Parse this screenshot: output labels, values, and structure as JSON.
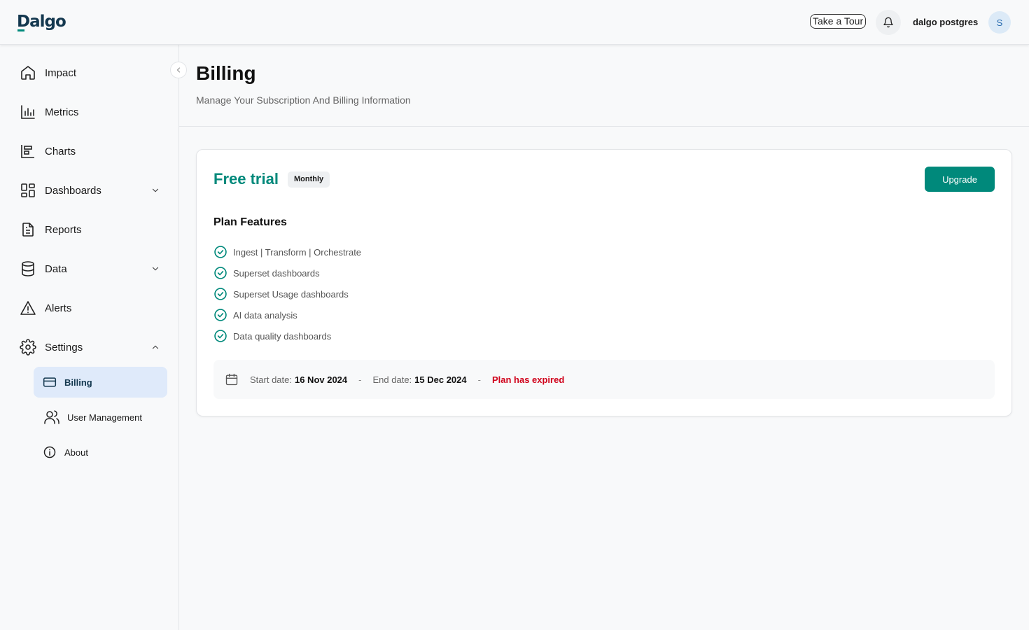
{
  "header": {
    "logo": "Dalgo",
    "tour_label": "Take a Tour",
    "user_name": "dalgo postgres",
    "avatar_initial": "S"
  },
  "sidebar": {
    "items": [
      {
        "label": "Impact",
        "icon": "home-icon"
      },
      {
        "label": "Metrics",
        "icon": "bar-chart-icon"
      },
      {
        "label": "Charts",
        "icon": "chart-icon"
      },
      {
        "label": "Dashboards",
        "icon": "grid-icon",
        "expandable": true
      },
      {
        "label": "Reports",
        "icon": "document-icon"
      },
      {
        "label": "Data",
        "icon": "database-icon",
        "expandable": true
      },
      {
        "label": "Alerts",
        "icon": "warning-icon"
      },
      {
        "label": "Settings",
        "icon": "gear-icon",
        "expanded": true
      }
    ],
    "subitems": [
      {
        "label": "Billing",
        "icon": "credit-card-icon",
        "active": true
      },
      {
        "label": "User Management",
        "icon": "users-icon"
      },
      {
        "label": "About",
        "icon": "info-icon"
      }
    ]
  },
  "page": {
    "title": "Billing",
    "subtitle": "Manage Your Subscription And Billing Information"
  },
  "plan": {
    "name": "Free trial",
    "cycle": "Monthly",
    "upgrade_label": "Upgrade",
    "features_title": "Plan Features",
    "features": [
      "Ingest | Transform | Orchestrate",
      "Superset dashboards",
      "Superset Usage dashboards",
      "AI data analysis",
      "Data quality dashboards"
    ],
    "start_label": "Start date:",
    "start_date": "16 Nov 2024",
    "separator": "-",
    "end_label": "End date:",
    "end_date": "15 Dec 2024",
    "status": "Plan has expired"
  },
  "colors": {
    "accent": "#00897b",
    "brand": "#14384f",
    "expired": "#d0021b",
    "active_bg": "#dfeafa"
  }
}
